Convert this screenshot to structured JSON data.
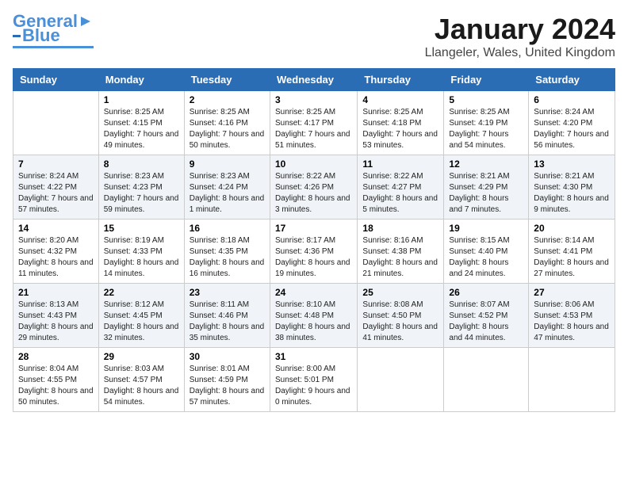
{
  "logo": {
    "line1": "General",
    "line2": "Blue"
  },
  "title": "January 2024",
  "location": "Llangeler, Wales, United Kingdom",
  "weekdays": [
    "Sunday",
    "Monday",
    "Tuesday",
    "Wednesday",
    "Thursday",
    "Friday",
    "Saturday"
  ],
  "weeks": [
    [
      {
        "day": "",
        "sunrise": "",
        "sunset": "",
        "daylight": ""
      },
      {
        "day": "1",
        "sunrise": "Sunrise: 8:25 AM",
        "sunset": "Sunset: 4:15 PM",
        "daylight": "Daylight: 7 hours and 49 minutes."
      },
      {
        "day": "2",
        "sunrise": "Sunrise: 8:25 AM",
        "sunset": "Sunset: 4:16 PM",
        "daylight": "Daylight: 7 hours and 50 minutes."
      },
      {
        "day": "3",
        "sunrise": "Sunrise: 8:25 AM",
        "sunset": "Sunset: 4:17 PM",
        "daylight": "Daylight: 7 hours and 51 minutes."
      },
      {
        "day": "4",
        "sunrise": "Sunrise: 8:25 AM",
        "sunset": "Sunset: 4:18 PM",
        "daylight": "Daylight: 7 hours and 53 minutes."
      },
      {
        "day": "5",
        "sunrise": "Sunrise: 8:25 AM",
        "sunset": "Sunset: 4:19 PM",
        "daylight": "Daylight: 7 hours and 54 minutes."
      },
      {
        "day": "6",
        "sunrise": "Sunrise: 8:24 AM",
        "sunset": "Sunset: 4:20 PM",
        "daylight": "Daylight: 7 hours and 56 minutes."
      }
    ],
    [
      {
        "day": "7",
        "sunrise": "Sunrise: 8:24 AM",
        "sunset": "Sunset: 4:22 PM",
        "daylight": "Daylight: 7 hours and 57 minutes."
      },
      {
        "day": "8",
        "sunrise": "Sunrise: 8:23 AM",
        "sunset": "Sunset: 4:23 PM",
        "daylight": "Daylight: 7 hours and 59 minutes."
      },
      {
        "day": "9",
        "sunrise": "Sunrise: 8:23 AM",
        "sunset": "Sunset: 4:24 PM",
        "daylight": "Daylight: 8 hours and 1 minute."
      },
      {
        "day": "10",
        "sunrise": "Sunrise: 8:22 AM",
        "sunset": "Sunset: 4:26 PM",
        "daylight": "Daylight: 8 hours and 3 minutes."
      },
      {
        "day": "11",
        "sunrise": "Sunrise: 8:22 AM",
        "sunset": "Sunset: 4:27 PM",
        "daylight": "Daylight: 8 hours and 5 minutes."
      },
      {
        "day": "12",
        "sunrise": "Sunrise: 8:21 AM",
        "sunset": "Sunset: 4:29 PM",
        "daylight": "Daylight: 8 hours and 7 minutes."
      },
      {
        "day": "13",
        "sunrise": "Sunrise: 8:21 AM",
        "sunset": "Sunset: 4:30 PM",
        "daylight": "Daylight: 8 hours and 9 minutes."
      }
    ],
    [
      {
        "day": "14",
        "sunrise": "Sunrise: 8:20 AM",
        "sunset": "Sunset: 4:32 PM",
        "daylight": "Daylight: 8 hours and 11 minutes."
      },
      {
        "day": "15",
        "sunrise": "Sunrise: 8:19 AM",
        "sunset": "Sunset: 4:33 PM",
        "daylight": "Daylight: 8 hours and 14 minutes."
      },
      {
        "day": "16",
        "sunrise": "Sunrise: 8:18 AM",
        "sunset": "Sunset: 4:35 PM",
        "daylight": "Daylight: 8 hours and 16 minutes."
      },
      {
        "day": "17",
        "sunrise": "Sunrise: 8:17 AM",
        "sunset": "Sunset: 4:36 PM",
        "daylight": "Daylight: 8 hours and 19 minutes."
      },
      {
        "day": "18",
        "sunrise": "Sunrise: 8:16 AM",
        "sunset": "Sunset: 4:38 PM",
        "daylight": "Daylight: 8 hours and 21 minutes."
      },
      {
        "day": "19",
        "sunrise": "Sunrise: 8:15 AM",
        "sunset": "Sunset: 4:40 PM",
        "daylight": "Daylight: 8 hours and 24 minutes."
      },
      {
        "day": "20",
        "sunrise": "Sunrise: 8:14 AM",
        "sunset": "Sunset: 4:41 PM",
        "daylight": "Daylight: 8 hours and 27 minutes."
      }
    ],
    [
      {
        "day": "21",
        "sunrise": "Sunrise: 8:13 AM",
        "sunset": "Sunset: 4:43 PM",
        "daylight": "Daylight: 8 hours and 29 minutes."
      },
      {
        "day": "22",
        "sunrise": "Sunrise: 8:12 AM",
        "sunset": "Sunset: 4:45 PM",
        "daylight": "Daylight: 8 hours and 32 minutes."
      },
      {
        "day": "23",
        "sunrise": "Sunrise: 8:11 AM",
        "sunset": "Sunset: 4:46 PM",
        "daylight": "Daylight: 8 hours and 35 minutes."
      },
      {
        "day": "24",
        "sunrise": "Sunrise: 8:10 AM",
        "sunset": "Sunset: 4:48 PM",
        "daylight": "Daylight: 8 hours and 38 minutes."
      },
      {
        "day": "25",
        "sunrise": "Sunrise: 8:08 AM",
        "sunset": "Sunset: 4:50 PM",
        "daylight": "Daylight: 8 hours and 41 minutes."
      },
      {
        "day": "26",
        "sunrise": "Sunrise: 8:07 AM",
        "sunset": "Sunset: 4:52 PM",
        "daylight": "Daylight: 8 hours and 44 minutes."
      },
      {
        "day": "27",
        "sunrise": "Sunrise: 8:06 AM",
        "sunset": "Sunset: 4:53 PM",
        "daylight": "Daylight: 8 hours and 47 minutes."
      }
    ],
    [
      {
        "day": "28",
        "sunrise": "Sunrise: 8:04 AM",
        "sunset": "Sunset: 4:55 PM",
        "daylight": "Daylight: 8 hours and 50 minutes."
      },
      {
        "day": "29",
        "sunrise": "Sunrise: 8:03 AM",
        "sunset": "Sunset: 4:57 PM",
        "daylight": "Daylight: 8 hours and 54 minutes."
      },
      {
        "day": "30",
        "sunrise": "Sunrise: 8:01 AM",
        "sunset": "Sunset: 4:59 PM",
        "daylight": "Daylight: 8 hours and 57 minutes."
      },
      {
        "day": "31",
        "sunrise": "Sunrise: 8:00 AM",
        "sunset": "Sunset: 5:01 PM",
        "daylight": "Daylight: 9 hours and 0 minutes."
      },
      {
        "day": "",
        "sunrise": "",
        "sunset": "",
        "daylight": ""
      },
      {
        "day": "",
        "sunrise": "",
        "sunset": "",
        "daylight": ""
      },
      {
        "day": "",
        "sunrise": "",
        "sunset": "",
        "daylight": ""
      }
    ]
  ]
}
